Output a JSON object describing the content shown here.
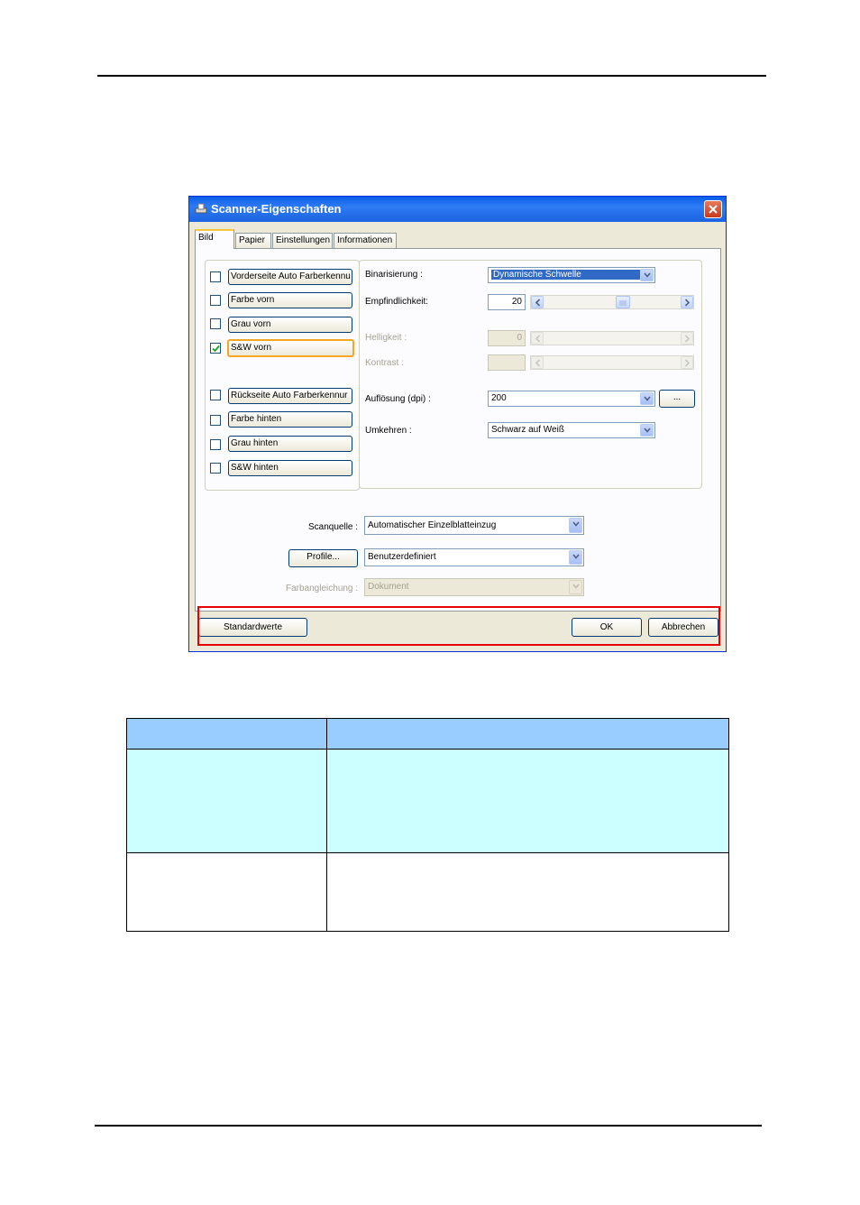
{
  "window": {
    "title": "Scanner-Eigenschaften",
    "tabs": [
      "Bild",
      "Papier",
      "Einstellungen",
      "Informationen"
    ],
    "active_tab": "Bild"
  },
  "image_types": [
    {
      "label": "Vorderseite Auto Farberkennu",
      "checked": false
    },
    {
      "label": "Farbe vorn",
      "checked": false
    },
    {
      "label": "Grau vorn",
      "checked": false
    },
    {
      "label": "S&W vorn",
      "checked": true
    },
    {
      "label": "Rückseite Auto Farberkennur",
      "checked": false
    },
    {
      "label": "Farbe hinten",
      "checked": false
    },
    {
      "label": "Grau hinten",
      "checked": false
    },
    {
      "label": "S&W hinten",
      "checked": false
    }
  ],
  "settings": {
    "binarization_label": "Binarisierung :",
    "binarization_value": "Dynamische Schwelle",
    "sensitivity_label": "Empfindlichkeit:",
    "sensitivity_value": "20",
    "sensitivity_fraction": 0.58,
    "brightness_label": "Helligkeit :",
    "brightness_value": "0",
    "contrast_label": "Kontrast :",
    "contrast_value": "",
    "resolution_label": "Auflösung (dpi) :",
    "resolution_value": "200",
    "resolution_more": "...",
    "invert_label": "Umkehren :",
    "invert_value": "Schwarz auf Weiß"
  },
  "lower": {
    "scan_source_label": "Scanquelle :",
    "scan_source_value": "Automatischer Einzelblatteinzug",
    "profile_button": "Profile...",
    "profile_value": "Benutzerdefiniert",
    "color_match_label": "Farbangleichung :",
    "color_match_value": "Dokument"
  },
  "buttons": {
    "defaults": "Standardwerte",
    "ok": "OK",
    "cancel": "Abbrechen"
  },
  "colors": {
    "highlight": "#e60000",
    "table_header": "#99ccff",
    "table_row": "#ccffff"
  }
}
